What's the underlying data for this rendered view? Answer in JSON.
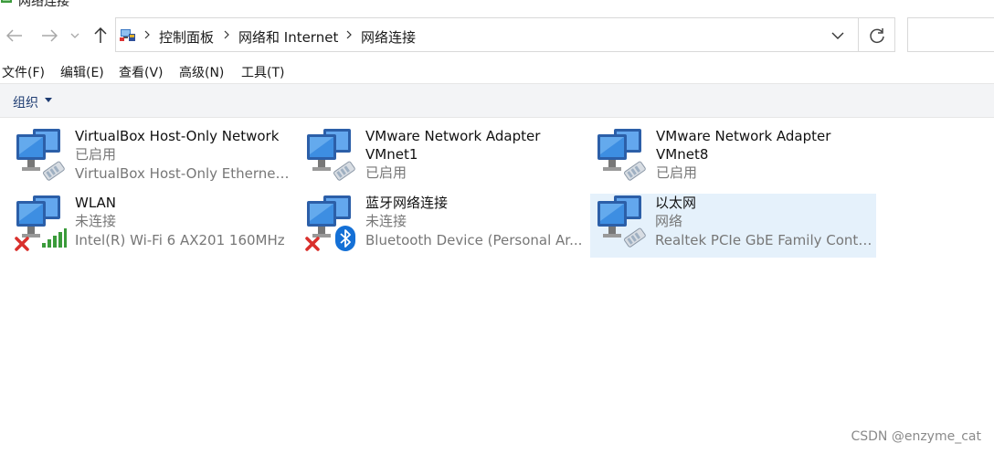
{
  "window": {
    "title": "网络连接"
  },
  "address_bar": {
    "breadcrumbs": [
      "控制面板",
      "网络和 Internet",
      "网络连接"
    ]
  },
  "menu": [
    "文件(F)",
    "编辑(E)",
    "查看(V)",
    "高级(N)",
    "工具(T)"
  ],
  "command_bar": {
    "organize_label": "组织"
  },
  "connections": [
    {
      "name": "VirtualBox Host-Only Network",
      "status": "已启用",
      "device": "VirtualBox Host-Only Ethernet ..."
    },
    {
      "name": "VMware Network Adapter VMnet1",
      "status": "已启用",
      "device": ""
    },
    {
      "name": "VMware Network Adapter VMnet8",
      "status": "已启用",
      "device": ""
    },
    {
      "name": "WLAN",
      "status": "未连接",
      "device": "Intel(R) Wi-Fi 6 AX201 160MHz",
      "badges": [
        "red-x-icon",
        "wifi-signal-icon"
      ]
    },
    {
      "name": "蓝牙网络连接",
      "status": "未连接",
      "device": "Bluetooth Device (Personal Ar...",
      "badges": [
        "red-x-icon",
        "bluetooth-icon"
      ]
    },
    {
      "name": "以太网",
      "status": "网络",
      "device": "Realtek PCIe GbE Family Contr...",
      "selected": true
    }
  ],
  "watermark": "CSDN @enzyme_cat",
  "colors": {
    "selection_bg": "#e5f1fb",
    "command_bar_bg": "#f3f4f6",
    "organize_text": "#1e3c72",
    "error_red": "#d9302c",
    "wifi_green": "#3a9b3a",
    "bluetooth_blue": "#1470d6"
  }
}
